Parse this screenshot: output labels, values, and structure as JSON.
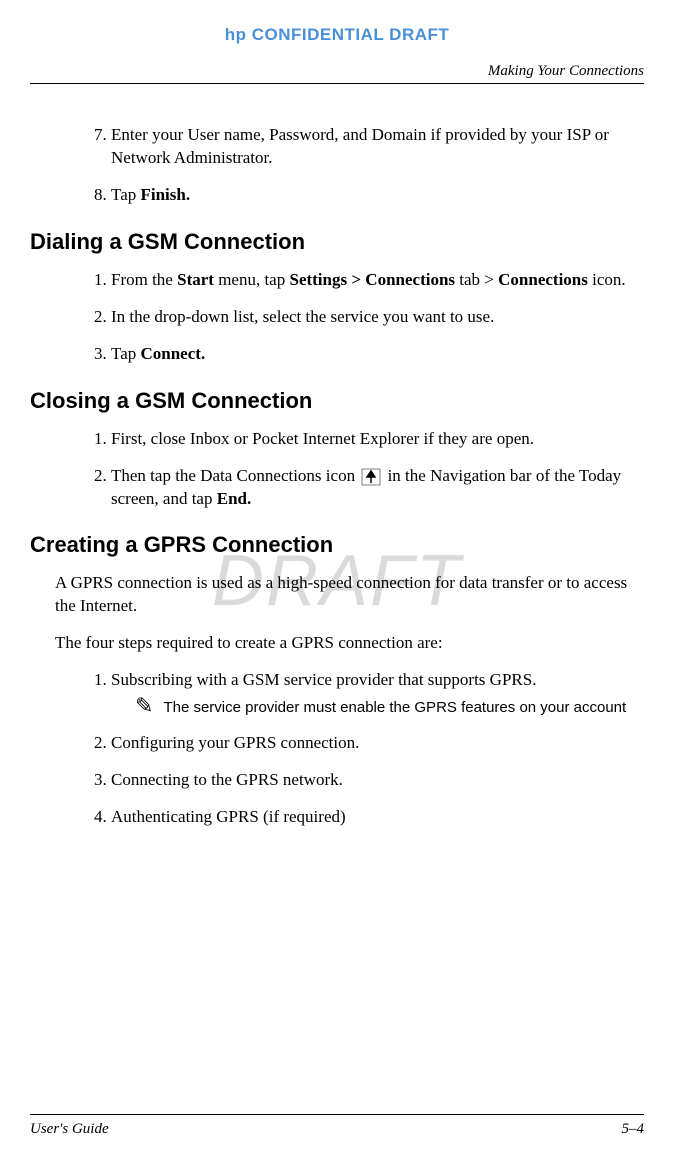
{
  "header": {
    "confidential": "hp CONFIDENTIAL DRAFT",
    "chapter": "Making Your Connections"
  },
  "watermark": "DRAFT",
  "steps_cont": {
    "item7_a": "Enter your User name, Password, and Domain if provided by your ISP or Network Administrator.",
    "item8_a": "Tap ",
    "item8_b": "Finish."
  },
  "section1": {
    "title": "Dialing a GSM Connection",
    "item1_a": "From the ",
    "item1_b": "Start",
    "item1_c": " menu, tap ",
    "item1_d": "Settings > Connections",
    "item1_e": " tab > ",
    "item1_f": "Connections",
    "item1_g": " icon.",
    "item2": "In the drop-down list, select the service you want to use.",
    "item3_a": "Tap ",
    "item3_b": "Connect."
  },
  "section2": {
    "title": "Closing a GSM Connection",
    "item1": "First, close Inbox or Pocket Internet Explorer if they are open.",
    "item2_a": "Then tap the Data Connections icon ",
    "item2_b": " in the Navigation bar of the Today screen, and tap ",
    "item2_c": "End."
  },
  "section3": {
    "title": "Creating a GPRS Connection",
    "para1": "A GPRS connection is used as a high-speed connection for data transfer or to access the Internet.",
    "para2": "The four steps required to create a GPRS connection are:",
    "item1": "Subscribing with a GSM service provider that supports GPRS.",
    "note": "The service provider must enable the GPRS features on your account",
    "item2": "Configuring your GPRS connection.",
    "item3": "Connecting to the GPRS network.",
    "item4": "Authenticating GPRS (if required)"
  },
  "footer": {
    "left": "User's Guide",
    "right": "5–4"
  }
}
